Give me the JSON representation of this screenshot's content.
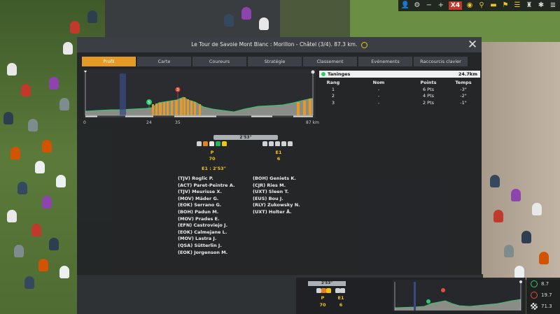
{
  "toolbar": {
    "speed_label": "X4",
    "icons": [
      "person-icon",
      "gear-icon",
      "minus-icon",
      "plus-icon",
      "speed-badge",
      "eye-icon",
      "bike-icon",
      "car-icon",
      "flag-icon",
      "menu-icon",
      "trophy-icon",
      "settings-icon",
      "list-icon"
    ]
  },
  "modal": {
    "title": "Le Tour de Savoie Mont Blanc : Morillon - Châtel (3/4). 87.3 km.",
    "close_label": "✕"
  },
  "tabs": [
    {
      "label": "Profil",
      "active": true
    },
    {
      "label": "Carte",
      "active": false
    },
    {
      "label": "Coureurs",
      "active": false
    },
    {
      "label": "Stratégie",
      "active": false
    },
    {
      "label": "Classement",
      "active": false
    },
    {
      "label": "Evénements",
      "active": false
    },
    {
      "label": "Raccourcis clavier",
      "active": false
    }
  ],
  "profile": {
    "km_labels": [
      "0",
      "24",
      "35",
      "87 km"
    ],
    "markers": [
      {
        "type": "sprint",
        "label": "S",
        "color": "#2ecc71"
      },
      {
        "type": "climb",
        "label": "3",
        "color": "#e74c3c"
      }
    ]
  },
  "climb": {
    "name": "Taninges",
    "distance": "24.7km",
    "headers": [
      "Rang",
      "Nom",
      "Points",
      "Temps"
    ],
    "rows": [
      {
        "rang": "1",
        "nom": "-",
        "points": "6 Pts",
        "temps": "-3\""
      },
      {
        "rang": "2",
        "nom": "-",
        "points": "4 Pts",
        "temps": "-2\""
      },
      {
        "rang": "3",
        "nom": "-",
        "points": "2 Pts",
        "temps": "-1\""
      }
    ]
  },
  "race": {
    "gap": "2'53\"",
    "groups": [
      {
        "label": "P",
        "count": "70"
      },
      {
        "label": "E1",
        "count": "6"
      }
    ],
    "e1_gap_label": "E1 : 2'53\"",
    "peloton_riders": [
      "(TJV) Roglic P.",
      "(ACT) Paret-Peintre A.",
      "(TJV) Meurisse X.",
      "(MOV) Mäder G.",
      "(EOK) Serrano G.",
      "(BOH) Padun M.",
      "(MOV) Prades E.",
      "(EFN) Castroviejo J.",
      "(EOK) Calmejane L.",
      "(MOV) Lastra J.",
      "(QSA) Sütterlin J.",
      "(EOK) Jorgenson M."
    ],
    "break_riders": [
      "(BOH) Geniets K.",
      "(CJR) Ries M.",
      "(UXT) Sleen T.",
      "(EUS) Bou J.",
      "(RLY) Zukowsky N.",
      "(UXT) Holter Å."
    ]
  },
  "minimap": {
    "gap": "2'53\"",
    "groups": [
      {
        "label": "P",
        "count": "70"
      },
      {
        "label": "E1",
        "count": "6"
      }
    ]
  },
  "stats": [
    {
      "icon": "energy-icon",
      "value": "8.7",
      "color": "#2ecc71"
    },
    {
      "icon": "heart-icon",
      "value": "19.7",
      "color": "#e74c3c"
    },
    {
      "icon": "finish-flag-icon",
      "value": "71.3",
      "color": "#cccccc"
    }
  ]
}
